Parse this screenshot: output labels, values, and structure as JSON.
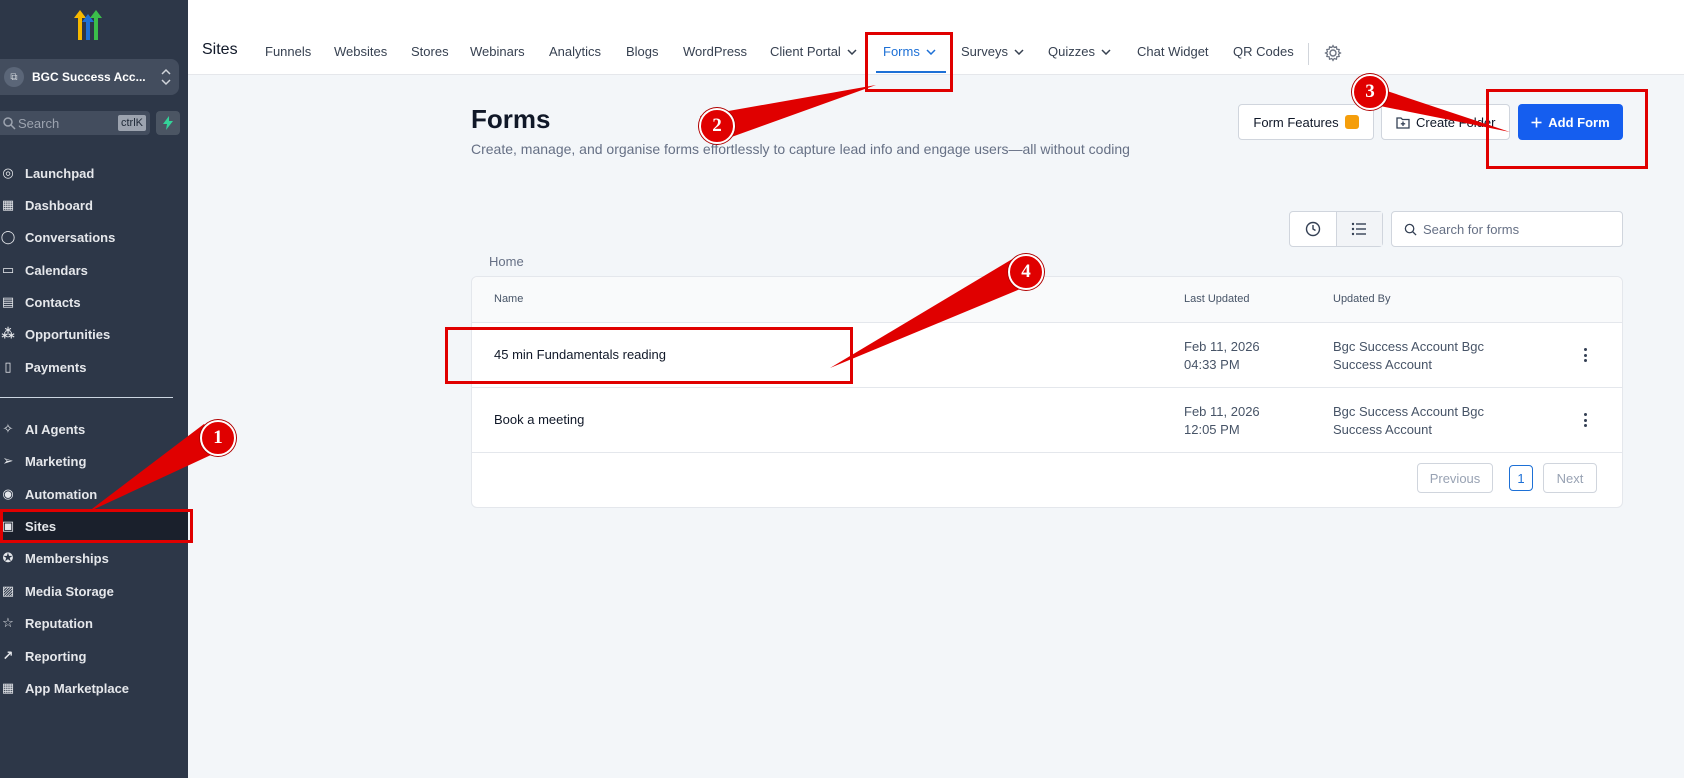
{
  "sidebar": {
    "account_name": "BGC Success Acc...",
    "search_placeholder": "Search",
    "search_shortcut": "ctrlK",
    "items": [
      {
        "label": "Launchpad",
        "icon": "launchpad-icon"
      },
      {
        "label": "Dashboard",
        "icon": "dashboard-icon"
      },
      {
        "label": "Conversations",
        "icon": "chat-bubble-icon"
      },
      {
        "label": "Calendars",
        "icon": "calendar-icon"
      },
      {
        "label": "Contacts",
        "icon": "contacts-icon"
      },
      {
        "label": "Opportunities",
        "icon": "opportunities-icon"
      },
      {
        "label": "Payments",
        "icon": "payments-icon"
      },
      {
        "label": "AI Agents",
        "icon": "sparkle-icon"
      },
      {
        "label": "Marketing",
        "icon": "send-icon"
      },
      {
        "label": "Automation",
        "icon": "automation-icon"
      },
      {
        "label": "Sites",
        "icon": "sites-icon",
        "active": true
      },
      {
        "label": "Memberships",
        "icon": "award-icon"
      },
      {
        "label": "Media Storage",
        "icon": "image-icon"
      },
      {
        "label": "Reputation",
        "icon": "star-icon"
      },
      {
        "label": "Reporting",
        "icon": "trend-icon"
      },
      {
        "label": "App Marketplace",
        "icon": "grid-icon"
      }
    ]
  },
  "topnav": {
    "title": "Sites",
    "tabs": [
      {
        "label": "Funnels"
      },
      {
        "label": "Websites"
      },
      {
        "label": "Stores"
      },
      {
        "label": "Webinars"
      },
      {
        "label": "Analytics"
      },
      {
        "label": "Blogs"
      },
      {
        "label": "WordPress"
      },
      {
        "label": "Client Portal",
        "dropdown": true
      },
      {
        "label": "Forms",
        "dropdown": true,
        "active": true
      },
      {
        "label": "Surveys",
        "dropdown": true
      },
      {
        "label": "Quizzes",
        "dropdown": true
      },
      {
        "label": "Chat Widget"
      },
      {
        "label": "QR Codes"
      }
    ]
  },
  "page": {
    "title": "Forms",
    "subtitle": "Create, manage, and organise forms effortlessly to capture lead info and engage users—all without coding",
    "buttons": {
      "features": "Form Features",
      "create_folder": "Create Folder",
      "add_form": "Add Form"
    },
    "search_placeholder": "Search for forms",
    "breadcrumb": "Home"
  },
  "table": {
    "columns": [
      "Name",
      "Last Updated",
      "Updated By"
    ],
    "rows": [
      {
        "name": "45 min Fundamentals reading",
        "date": "Feb 11, 2026",
        "time": "04:33 PM",
        "updated_by": "Bgc Success Account Bgc Success Account"
      },
      {
        "name": "Book a meeting",
        "date": "Feb 11, 2026",
        "time": "12:05 PM",
        "updated_by": "Bgc Success Account Bgc Success Account"
      }
    ],
    "pagination": {
      "previous": "Previous",
      "current": "1",
      "next": "Next"
    }
  },
  "annotations": {
    "badges": [
      "1",
      "2",
      "3",
      "4"
    ],
    "color": "#e00000"
  },
  "colors": {
    "sidebar_bg": "#2d3748",
    "accent": "#155eef",
    "active_tab": "#1d70d6"
  }
}
